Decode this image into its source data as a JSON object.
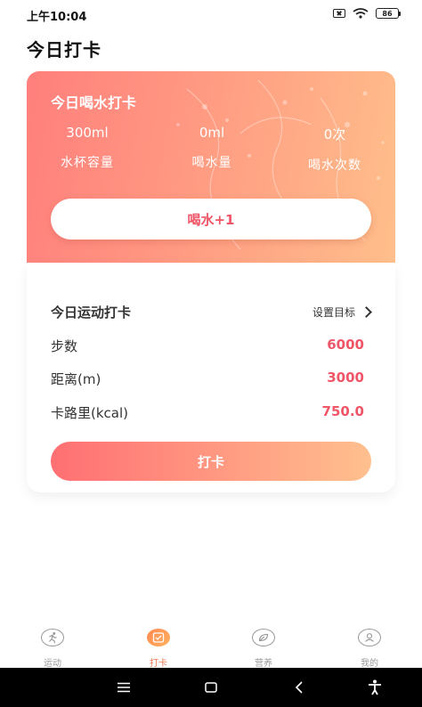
{
  "status_bar": {
    "time": "上午10:04",
    "battery": "86"
  },
  "page": {
    "title": "今日打卡"
  },
  "water": {
    "title": "今日喝水打卡",
    "stats": [
      {
        "value": "300ml",
        "label": "水杯容量"
      },
      {
        "value": "0ml",
        "label": "喝水量"
      },
      {
        "value": "0次",
        "label": "喝水次数"
      }
    ],
    "drink_button": "喝水+1"
  },
  "exercise": {
    "title": "今日运动打卡",
    "set_goal": "设置目标",
    "rows": [
      {
        "label": "步数",
        "value": "6000"
      },
      {
        "label": "距离(m)",
        "value": "3000"
      },
      {
        "label": "卡路里(kcal)",
        "value": "750.0"
      }
    ],
    "checkin_button": "打卡"
  },
  "tabs": [
    {
      "label": "运动",
      "icon": "running-icon",
      "active": false
    },
    {
      "label": "打卡",
      "icon": "calendar-check-icon",
      "active": true
    },
    {
      "label": "营养",
      "icon": "leaf-icon",
      "active": false
    },
    {
      "label": "我的",
      "icon": "person-icon",
      "active": false
    }
  ],
  "colors": {
    "accent": "#ef5668",
    "gradient_start": "#ff7f7c",
    "gradient_end": "#ffbf8b",
    "active_tab": "#f07a55"
  }
}
